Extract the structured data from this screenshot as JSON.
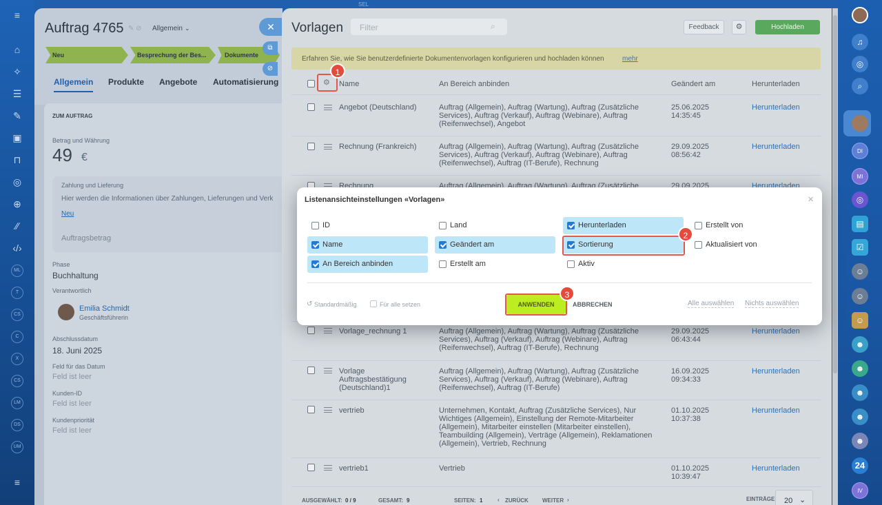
{
  "deal": {
    "title": "Auftrag 4765",
    "category": "Allgemein",
    "stages": [
      "Neu",
      "Besprechung der Bes...",
      "Dokumente vorbere"
    ],
    "tabs": [
      "Allgemein",
      "Produkte",
      "Angebote",
      "Automatisierung"
    ],
    "section_title": "ZUM AUFTRAG",
    "amount_label": "Betrag und Währung",
    "amount": "49",
    "currency": "€",
    "payment_title": "Zahlung und Lieferung",
    "payment_text": "Hier werden die Informationen über Zahlungen, Lieferungen und Verk",
    "new_link": "Neu",
    "order_amount_label": "Auftragsbetrag",
    "phase_label": "Phase",
    "phase_value": "Buchhaltung",
    "responsible_label": "Verantwortlich",
    "responsible_name": "Emilia Schmidt",
    "responsible_role": "Geschäftsführerin",
    "close_date_label": "Abschlussdatum",
    "close_date": "18. Juni 2025",
    "field1_label": "Feld für das Datum",
    "field1_value": "Feld ist leer",
    "field2_label": "Kunden-ID",
    "field2_value": "Feld ist leer",
    "field3_label": "Kundenpriorität",
    "field3_value": "Feld ist leer"
  },
  "templates": {
    "title": "Vorlagen",
    "filter_placeholder": "Filter",
    "feedback": "Feedback",
    "upload": "Hochladen",
    "info_text": "Erfahren Sie, wie Sie benutzerdefinierte Dokumentenvorlagen konfigurieren und hochladen können",
    "info_link": "mehr",
    "columns": [
      "Name",
      "An Bereich anbinden",
      "Geändert am",
      "Herunterladen"
    ],
    "rows": [
      {
        "name": "Angebot (Deutschland)",
        "binding": "Auftrag (Allgemein), Auftrag (Wartung), Auftrag (Zusätzliche Services), Auftrag (Verkauf), Auftrag (Webinare), Auftrag (Reifenwechsel), Angebot",
        "date": "25.06.2025",
        "time": "14:35:45",
        "download": "Herunterladen"
      },
      {
        "name": "Rechnung (Frankreich)",
        "binding": "Auftrag (Allgemein), Auftrag (Wartung), Auftrag (Zusätzliche Services), Auftrag (Verkauf), Auftrag (Webinare), Auftrag (Reifenwechsel), Auftrag (IT-Berufe), Rechnung",
        "date": "29.09.2025",
        "time": "08:56:42",
        "download": "Herunterladen"
      },
      {
        "name": "Rechnung",
        "binding": "Auftrag (Allgemein), Auftrag (Wartung), Auftrag (Zusätzliche",
        "date": "29.09.2025",
        "time": "",
        "download": "Herunterladen"
      },
      {
        "name": "Vorlage_rechnung 1",
        "binding": "Auftrag (Allgemein), Auftrag (Wartung), Auftrag (Zusätzliche Services), Auftrag (Verkauf), Auftrag (Webinare), Auftrag (Reifenwechsel), Auftrag (IT-Berufe), Rechnung",
        "date": "29.09.2025",
        "time": "06:43:44",
        "download": "Herunterladen"
      },
      {
        "name": "Vorlage Auftragsbestätigung (Deutschland)1",
        "binding": "Auftrag (Allgemein), Auftrag (Wartung), Auftrag (Zusätzliche Services), Auftrag (Verkauf), Auftrag (Webinare), Auftrag (Reifenwechsel), Auftrag (IT-Berufe)",
        "date": "16.09.2025",
        "time": "09:34:33",
        "download": "Herunterladen"
      },
      {
        "name": "vertrieb",
        "binding": "Unternehmen, Kontakt, Auftrag (Zusätzliche Services), Nur Wichtiges (Allgemein), Einstellung der Remote-Mitarbeiter (Allgemein), Mitarbeiter einstellen (Mitarbeiter einstellen), Teambuilding (Allgemein), Verträge (Allgemein), Reklamationen (Allgemein), Vertrieb, Rechnung",
        "date": "01.10.2025",
        "time": "10:37:38",
        "download": "Herunterladen"
      },
      {
        "name": "vertrieb1",
        "binding": "Vertrieb",
        "date": "01.10.2025",
        "time": "10:39:47",
        "download": "Herunterladen"
      }
    ],
    "footer": {
      "selected_label": "AUSGEWÄHLT:",
      "selected_value": "0 / 9",
      "total_label": "GESAMT:",
      "total_value": "9",
      "pages_label": "SEITEN:",
      "pages_value": "1",
      "back": "ZURÜCK",
      "next": "WEITER",
      "entries_label": "EINTRÄGE",
      "entries_value": "20"
    }
  },
  "modal": {
    "title": "Listenansichteinstellungen «Vorlagen»",
    "options": [
      {
        "label": "ID",
        "checked": false
      },
      {
        "label": "Land",
        "checked": false
      },
      {
        "label": "Herunterladen",
        "checked": true
      },
      {
        "label": "Erstellt von",
        "checked": false
      },
      {
        "label": "Name",
        "checked": true
      },
      {
        "label": "Geändert am",
        "checked": true
      },
      {
        "label": "Sortierung",
        "checked": true
      },
      {
        "label": "Aktualisiert von",
        "checked": false
      },
      {
        "label": "An Bereich anbinden",
        "checked": true
      },
      {
        "label": "Erstellt am",
        "checked": false
      },
      {
        "label": "Aktiv",
        "checked": false
      }
    ],
    "default_label": "Standardmäßig",
    "for_all_label": "Für alle setzen",
    "apply": "ANWENDEN",
    "cancel": "ABBRECHEN",
    "select_all": "Alle auswählen",
    "select_none": "Nichts auswählen"
  },
  "steps": [
    "1",
    "2",
    "3"
  ],
  "right_rail_labels": [
    "DI",
    "MI",
    "24",
    "IV"
  ],
  "left_rail_labels": [
    "ML",
    "T",
    "CS",
    "C",
    "X",
    "CS",
    "LM",
    "DS",
    "UM"
  ],
  "top_label": "SEL"
}
